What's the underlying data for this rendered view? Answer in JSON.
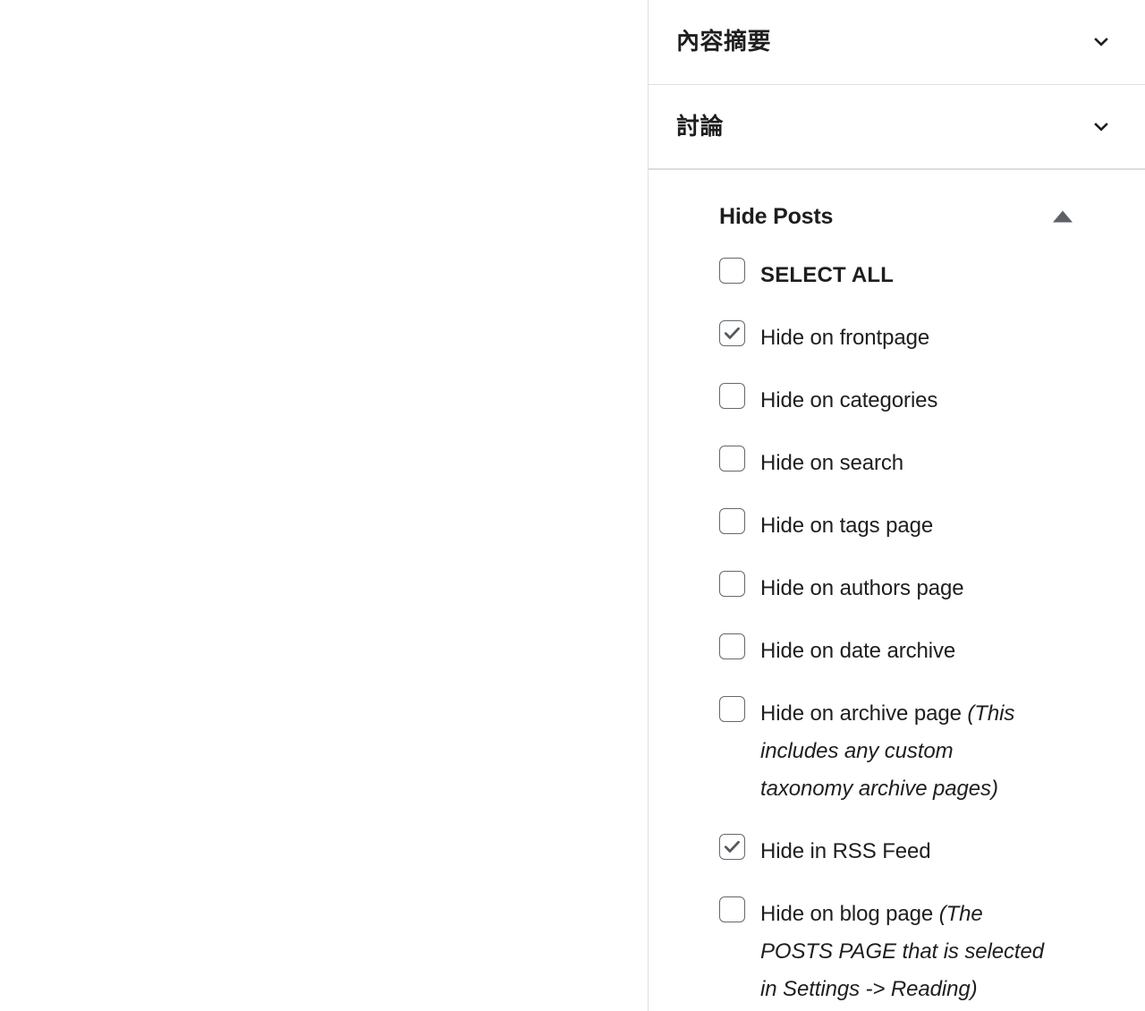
{
  "sidebar": {
    "panels": [
      {
        "title": "內容摘要",
        "state": "collapsed",
        "icon": "chevron-down-icon"
      },
      {
        "title": "討論",
        "state": "collapsed",
        "icon": "chevron-down-icon"
      }
    ],
    "hide_posts_panel": {
      "title": "Hide Posts",
      "state": "expanded",
      "toggle_icon": "triangle-up-icon",
      "options": [
        {
          "label": "SELECT ALL",
          "note": "",
          "checked": false,
          "bold": true
        },
        {
          "label": "Hide on frontpage",
          "note": "",
          "checked": true,
          "bold": false
        },
        {
          "label": "Hide on categories",
          "note": "",
          "checked": false,
          "bold": false
        },
        {
          "label": "Hide on search",
          "note": "",
          "checked": false,
          "bold": false
        },
        {
          "label": "Hide on tags page",
          "note": "",
          "checked": false,
          "bold": false
        },
        {
          "label": "Hide on authors page",
          "note": "",
          "checked": false,
          "bold": false
        },
        {
          "label": "Hide on date archive",
          "note": "",
          "checked": false,
          "bold": false
        },
        {
          "label": "Hide on archive page",
          "note": "(This includes any custom taxonomy archive pages)",
          "checked": false,
          "bold": false
        },
        {
          "label": "Hide in RSS Feed",
          "note": "",
          "checked": true,
          "bold": false
        },
        {
          "label": "Hide on blog page",
          "note": "(The POSTS PAGE that is selected in Settings -> Reading)",
          "checked": false,
          "bold": false
        }
      ]
    }
  },
  "colors": {
    "text": "#1e1e1e",
    "border": "#e0e0e0",
    "checkbox_border": "#64686e",
    "check_mark": "#54585e",
    "triangle": "#5d6066",
    "background": "#ffffff"
  }
}
